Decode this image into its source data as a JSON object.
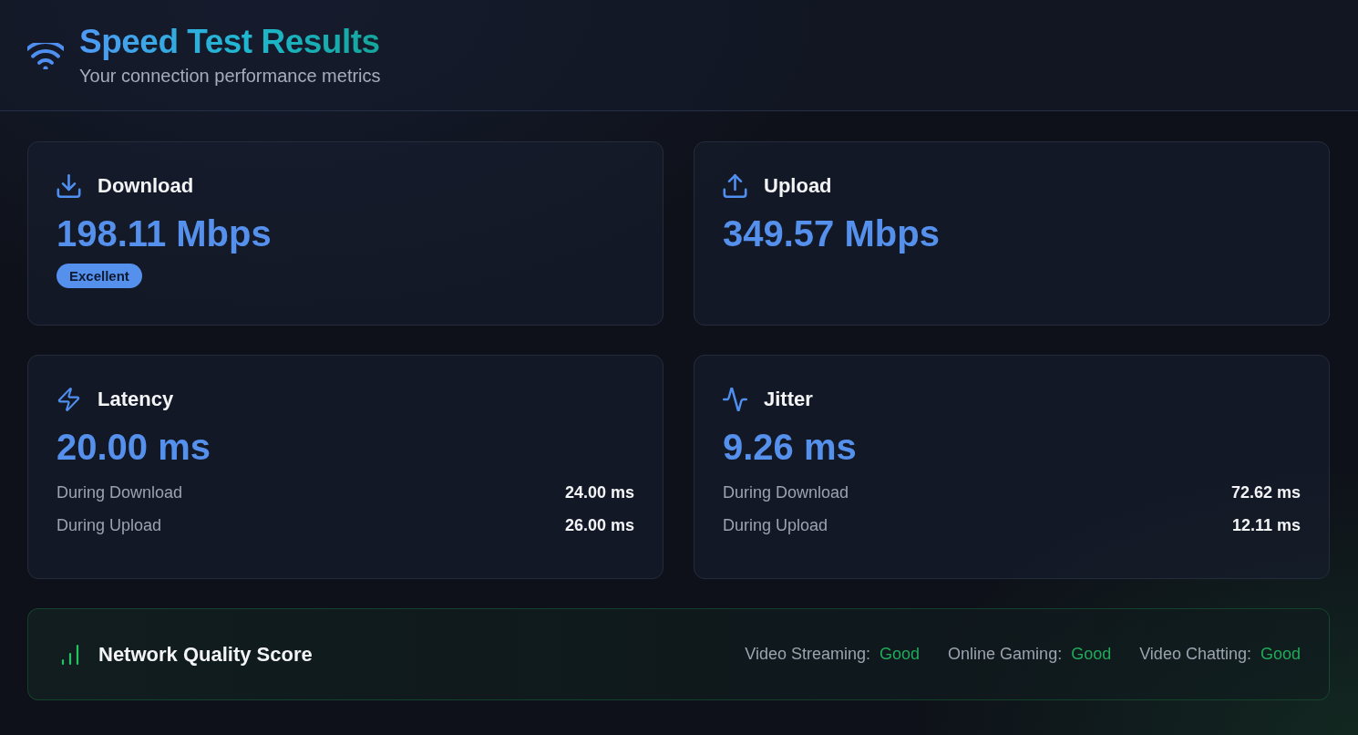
{
  "header": {
    "title": "Speed Test Results",
    "subtitle": "Your connection performance metrics"
  },
  "metrics": [
    {
      "kind": "download",
      "label": "Download",
      "value": "198.11 Mbps",
      "badge": "Excellent"
    },
    {
      "kind": "upload",
      "label": "Upload",
      "value": "349.57 Mbps"
    },
    {
      "kind": "latency",
      "label": "Latency",
      "value": "20.00 ms",
      "details": [
        {
          "label": "During Download",
          "value": "24.00 ms"
        },
        {
          "label": "During Upload",
          "value": "26.00 ms"
        }
      ]
    },
    {
      "kind": "jitter",
      "label": "Jitter",
      "value": "9.26 ms",
      "details": [
        {
          "label": "During Download",
          "value": "72.62 ms"
        },
        {
          "label": "During Upload",
          "value": "12.11 ms"
        }
      ]
    }
  ],
  "quality": {
    "title": "Network Quality Score",
    "items": [
      {
        "label": "Video Streaming:",
        "value": "Good"
      },
      {
        "label": "Online Gaming:",
        "value": "Good"
      },
      {
        "label": "Video Chatting:",
        "value": "Good"
      }
    ]
  }
}
